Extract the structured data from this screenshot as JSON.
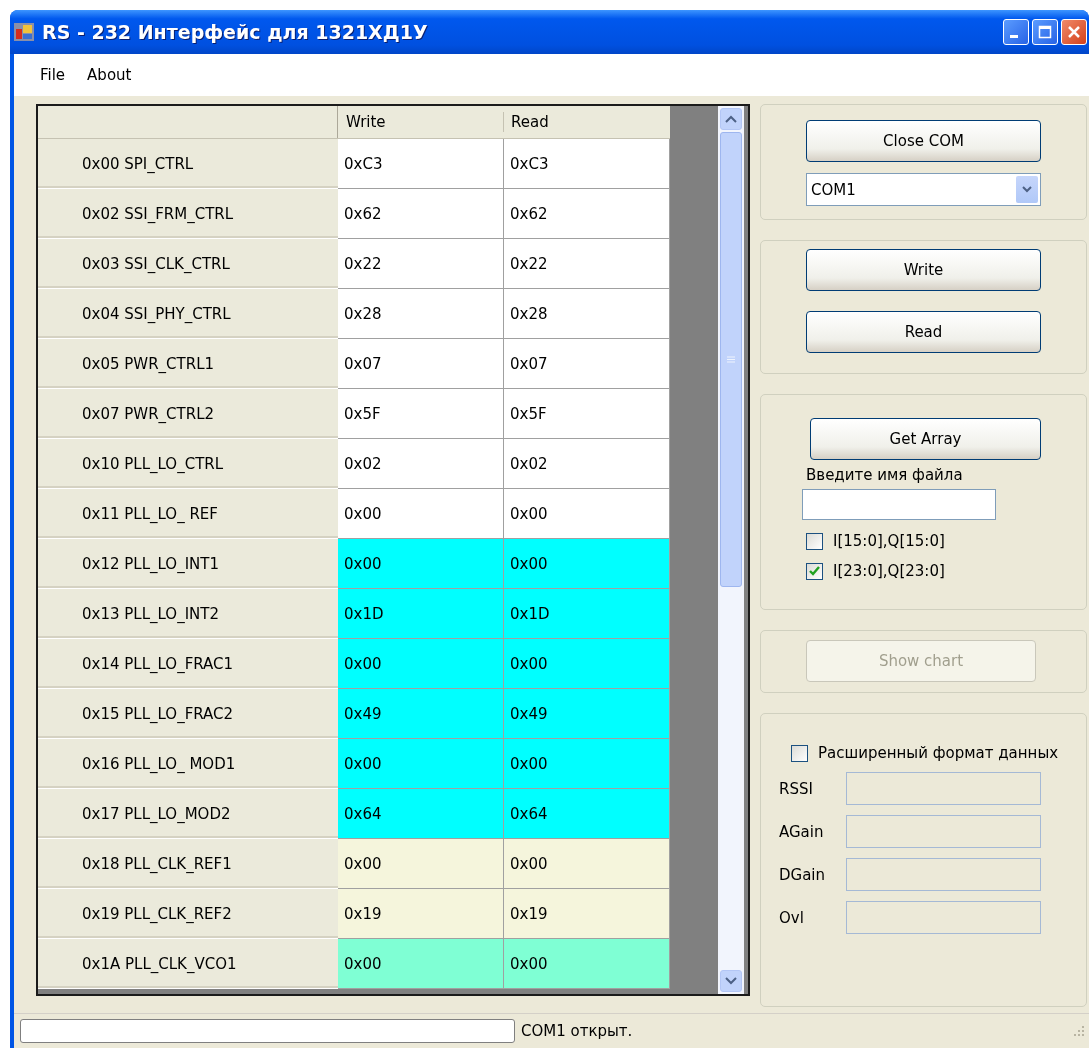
{
  "window": {
    "title": "RS - 232 Интерфейс для 1321ХД1У"
  },
  "menu": [
    "File",
    "About"
  ],
  "grid": {
    "columns": [
      "Write",
      "Read"
    ],
    "rows": [
      {
        "register": "0x00 SPI_CTRL",
        "write": "0xC3",
        "read": "0xC3",
        "color": "#ffffff"
      },
      {
        "register": "0x02 SSI_FRM_CTRL",
        "write": "0x62",
        "read": "0x62",
        "color": "#ffffff"
      },
      {
        "register": "0x03 SSI_CLK_CTRL",
        "write": "0x22",
        "read": "0x22",
        "color": "#ffffff"
      },
      {
        "register": "0x04 SSI_PHY_CTRL",
        "write": "0x28",
        "read": "0x28",
        "color": "#ffffff"
      },
      {
        "register": "0x05 PWR_CTRL1",
        "write": "0x07",
        "read": "0x07",
        "color": "#ffffff"
      },
      {
        "register": "0x07 PWR_CTRL2",
        "write": "0x5F",
        "read": "0x5F",
        "color": "#ffffff"
      },
      {
        "register": "0x10 PLL_LO_CTRL",
        "write": "0x02",
        "read": "0x02",
        "color": "#ffffff"
      },
      {
        "register": "0x11 PLL_LO_ REF",
        "write": "0x00",
        "read": "0x00",
        "color": "#ffffff"
      },
      {
        "register": "0x12 PLL_LO_INT1",
        "write": "0x00",
        "read": "0x00",
        "color": "#00ffff"
      },
      {
        "register": "0x13 PLL_LO_INT2",
        "write": "0x1D",
        "read": "0x1D",
        "color": "#00ffff"
      },
      {
        "register": "0x14 PLL_LO_FRAC1",
        "write": "0x00",
        "read": "0x00",
        "color": "#00ffff"
      },
      {
        "register": "0x15 PLL_LO_FRAC2",
        "write": "0x49",
        "read": "0x49",
        "color": "#00ffff"
      },
      {
        "register": "0x16 PLL_LO_ MOD1",
        "write": "0x00",
        "read": "0x00",
        "color": "#00ffff"
      },
      {
        "register": "0x17 PLL_LO_MOD2",
        "write": "0x64",
        "read": "0x64",
        "color": "#00ffff"
      },
      {
        "register": "0x18 PLL_CLK_REF1",
        "write": "0x00",
        "read": "0x00",
        "color": "#f5f5dc"
      },
      {
        "register": "0x19 PLL_CLK_REF2",
        "write": "0x19",
        "read": "0x19",
        "color": "#f5f5dc"
      },
      {
        "register": "0x1A PLL_CLK_VCO1",
        "write": "0x00",
        "read": "0x00",
        "color": "#7fffd4"
      }
    ]
  },
  "port_panel": {
    "button": "Close COM",
    "port": "COM1"
  },
  "io_panel": {
    "buttons": [
      "Write",
      "Read"
    ]
  },
  "array_panel": {
    "button": "Get Array",
    "file_label": "Введите имя файла",
    "formats": [
      {
        "label": "I[15:0],Q[15:0]",
        "checked": false
      },
      {
        "label": "I[23:0],Q[23:0]",
        "checked": true
      }
    ]
  },
  "chart_panel": {
    "button": {
      "label": "Show chart",
      "disabled": true
    }
  },
  "extended_panel": {
    "checkbox": {
      "label": "Расширенный формат данных",
      "checked": false
    },
    "fields": [
      "RSSI",
      "AGain",
      "DGain",
      "Ovl"
    ]
  },
  "status_bar": {
    "text": "COM1 открыт."
  }
}
